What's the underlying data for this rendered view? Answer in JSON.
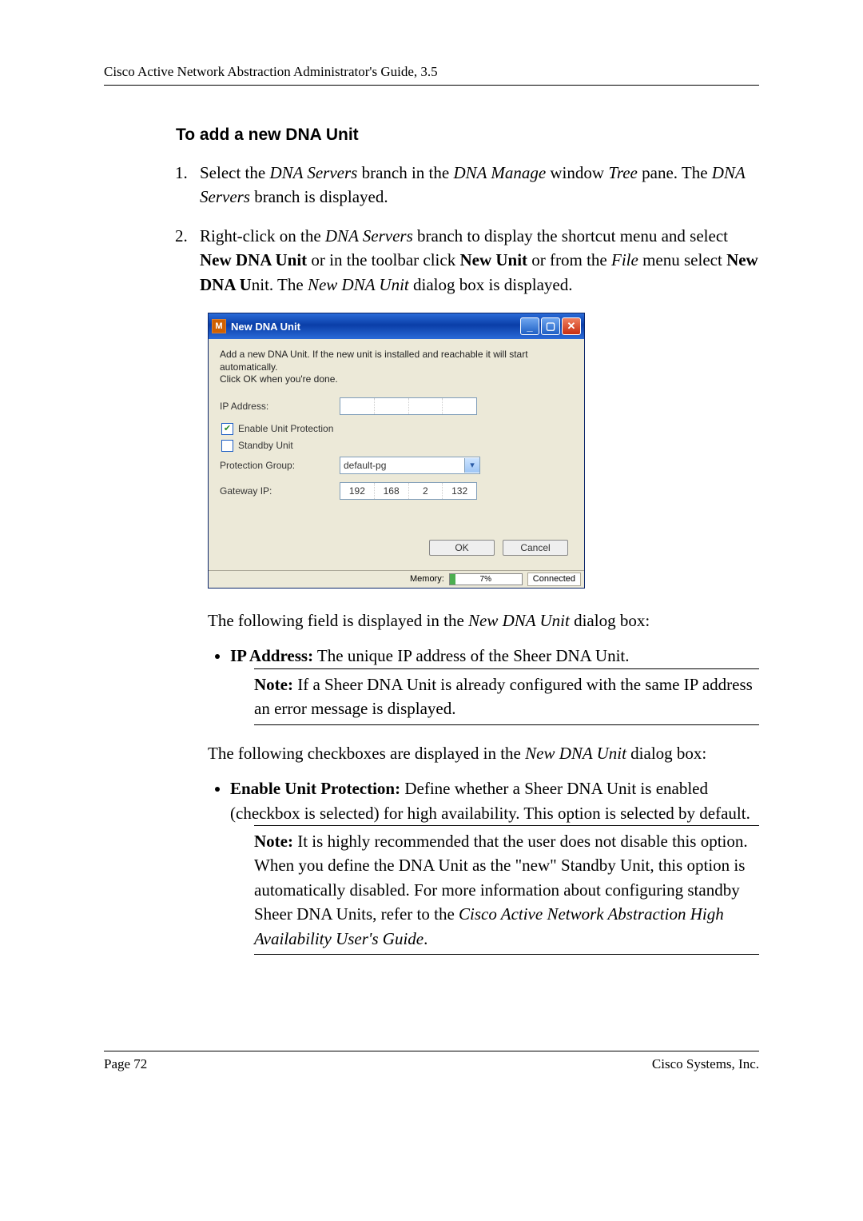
{
  "header": "Cisco Active Network Abstraction Administrator's Guide, 3.5",
  "section_heading": "To add a new DNA Unit",
  "steps": {
    "s1": {
      "pre": "Select the ",
      "i1": "DNA Servers",
      "mid1": " branch in the ",
      "i2": "DNA Manage",
      "mid2": " window ",
      "i3": "Tree",
      "mid3": " pane. The ",
      "i4": "DNA Servers",
      "post": " branch is displayed."
    },
    "s2": {
      "pre": "Right-click on the ",
      "i1": "DNA Servers",
      "mid1": " branch to display the shortcut menu and select ",
      "b1": "New DNA Unit",
      "mid2": " or in the toolbar click ",
      "b2": "New Unit",
      "mid3": " or from the ",
      "i2": "File",
      "mid4": " menu select ",
      "b3": "New DNA U",
      "mid5": "nit. The ",
      "i3": "New DNA Unit",
      "post": " dialog box is displayed."
    }
  },
  "dialog": {
    "app_icon": "M",
    "title": "New DNA Unit",
    "desc": "Add a new DNA Unit. If the new unit is installed and reachable it will start automatically.\nClick OK when you're done.",
    "ip_label": "IP Address:",
    "ip": {
      "a": "",
      "b": "",
      "c": "",
      "d": ""
    },
    "chk_enable": "Enable Unit Protection",
    "chk_standby": "Standby Unit",
    "pg_label": "Protection Group:",
    "pg_value": "default-pg",
    "gw_label": "Gateway IP:",
    "gw": {
      "a": "192",
      "b": "168",
      "c": "2",
      "d": "132"
    },
    "ok": "OK",
    "cancel": "Cancel",
    "mem_label": "Memory:",
    "mem_pct": "7%",
    "connected": "Connected"
  },
  "after_dialog": {
    "line1_pre": "The following field is displayed in the ",
    "line1_i": "New DNA Unit",
    "line1_post": " dialog box:",
    "ip_bullet_b": "IP Address:",
    "ip_bullet_t": " The unique IP address of the Sheer DNA Unit.",
    "note1_b": "Note:",
    "note1_t": " If a Sheer DNA Unit is already configured with the same IP address an error message is displayed.",
    "line2_pre": "The following checkboxes are displayed in the ",
    "line2_i": "New DNA Unit",
    "line2_post": " dialog box:",
    "eup_bullet_b": "Enable Unit Protection:",
    "eup_bullet_t": " Define whether a Sheer DNA Unit is enabled (checkbox is selected) for high availability. This option is selected by default.",
    "note2_b": "Note:",
    "note2_t1": " It is highly recommended that the user does not disable this option. When you define the DNA Unit as the \"new\" Standby Unit, this option is automatically disabled. For more information about configuring standby Sheer DNA Units, refer to the ",
    "note2_i": "Cisco Active Network Abstraction High Availability User's Guide",
    "note2_t2": "."
  },
  "footer": {
    "left": "Page 72",
    "right": "Cisco Systems, Inc."
  }
}
